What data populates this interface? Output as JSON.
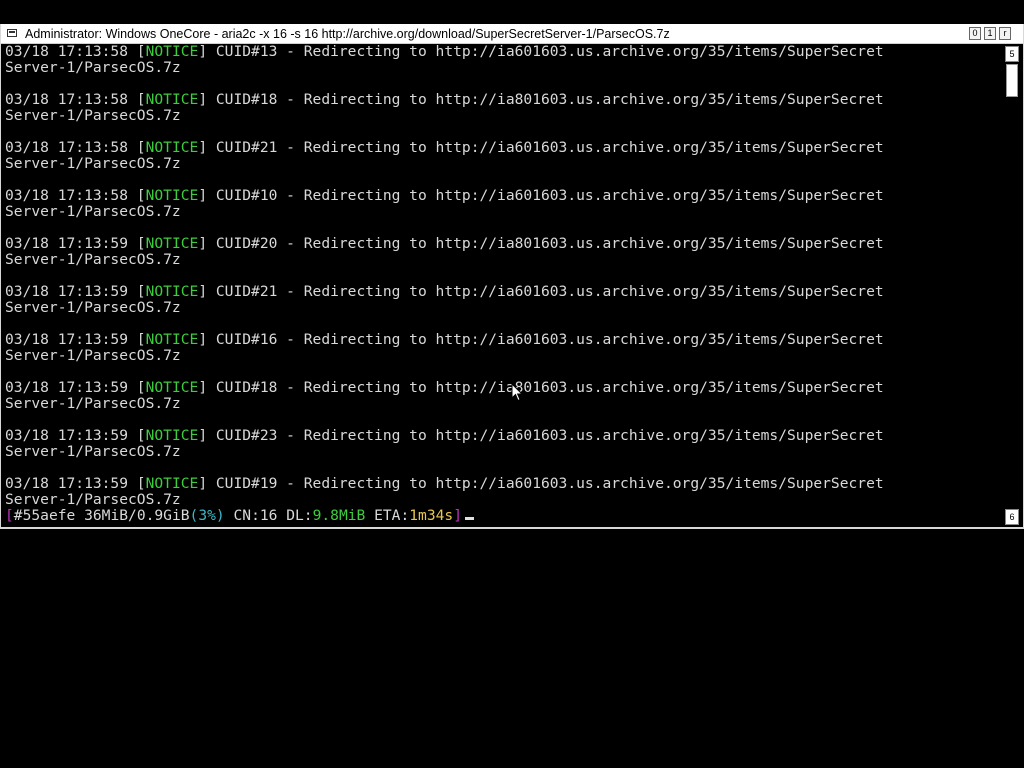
{
  "window": {
    "title": "Administrator:  Windows OneCore - aria2c  -x 16 -s 16 http://archive.org/download/SuperSecretServer-1/ParsecOS.7z",
    "minimize_glyph": "0",
    "maximize_glyph": "1",
    "close_glyph": "r",
    "scroll_up_glyph": "5",
    "scroll_down_glyph": "6"
  },
  "log_entries": [
    {
      "time": "03/18 17:13:58",
      "level": "NOTICE",
      "message": "CUID#13 - Redirecting to http://ia601603.us.archive.org/35/items/SuperSecret",
      "cont": "Server-1/ParsecOS.7z"
    },
    {
      "time": "03/18 17:13:58",
      "level": "NOTICE",
      "message": "CUID#18 - Redirecting to http://ia801603.us.archive.org/35/items/SuperSecret",
      "cont": "Server-1/ParsecOS.7z"
    },
    {
      "time": "03/18 17:13:58",
      "level": "NOTICE",
      "message": "CUID#21 - Redirecting to http://ia601603.us.archive.org/35/items/SuperSecret",
      "cont": "Server-1/ParsecOS.7z"
    },
    {
      "time": "03/18 17:13:58",
      "level": "NOTICE",
      "message": "CUID#10 - Redirecting to http://ia601603.us.archive.org/35/items/SuperSecret",
      "cont": "Server-1/ParsecOS.7z"
    },
    {
      "time": "03/18 17:13:59",
      "level": "NOTICE",
      "message": "CUID#20 - Redirecting to http://ia801603.us.archive.org/35/items/SuperSecret",
      "cont": "Server-1/ParsecOS.7z"
    },
    {
      "time": "03/18 17:13:59",
      "level": "NOTICE",
      "message": "CUID#21 - Redirecting to http://ia601603.us.archive.org/35/items/SuperSecret",
      "cont": "Server-1/ParsecOS.7z"
    },
    {
      "time": "03/18 17:13:59",
      "level": "NOTICE",
      "message": "CUID#16 - Redirecting to http://ia601603.us.archive.org/35/items/SuperSecret",
      "cont": "Server-1/ParsecOS.7z"
    },
    {
      "time": "03/18 17:13:59",
      "level": "NOTICE",
      "message": "CUID#18 - Redirecting to http://ia801603.us.archive.org/35/items/SuperSecret",
      "cont": "Server-1/ParsecOS.7z"
    },
    {
      "time": "03/18 17:13:59",
      "level": "NOTICE",
      "message": "CUID#23 - Redirecting to http://ia601603.us.archive.org/35/items/SuperSecret",
      "cont": "Server-1/ParsecOS.7z"
    },
    {
      "time": "03/18 17:13:59",
      "level": "NOTICE",
      "message": "CUID#19 - Redirecting to http://ia601603.us.archive.org/35/items/SuperSecret",
      "cont": "Server-1/ParsecOS.7z"
    }
  ],
  "status": {
    "gid": "#55aefe",
    "progress": "36MiB/0.9GiB",
    "percent": "(3%)",
    "cn_label": "CN:",
    "connections": "16",
    "dl_label": "DL:",
    "speed": "9.8MiB",
    "eta_label": "ETA:",
    "eta": "1m34s"
  },
  "colors": {
    "notice": "#3dcd3d",
    "bracket": "#c030c0",
    "eta": "#e6c84d",
    "percent": "#3ab7c7",
    "text": "#d9d9d9",
    "background": "#000000"
  }
}
